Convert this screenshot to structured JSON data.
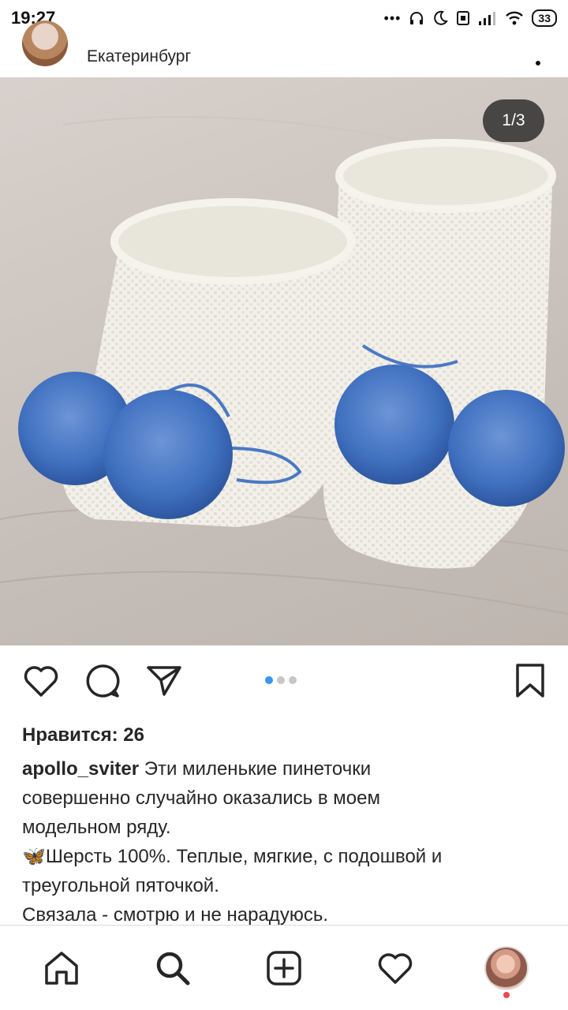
{
  "status_bar": {
    "time": "19:27",
    "battery": "33"
  },
  "post": {
    "location": "Екатеринбург",
    "image_counter": "1/3",
    "carousel": {
      "count": 3,
      "active": 0
    },
    "likes_text": "Нравится: 26",
    "caption": {
      "username": "apollo_sviter",
      "line1": "Эти миленькие пинеточки",
      "line2": "совершенно случайно оказались в моем",
      "line3": "модельном ряду.",
      "line4": "🦋Шерсть 100%. Теплые, мягкие, с подошвой и",
      "line5": "треугольной пяточкой.",
      "line6": "Связала - смотрю и не нарадуюсь."
    }
  },
  "colors": {
    "accent_dot": "#3897f0",
    "notification": "#ed4956",
    "pompom": "#3f6fbf"
  }
}
